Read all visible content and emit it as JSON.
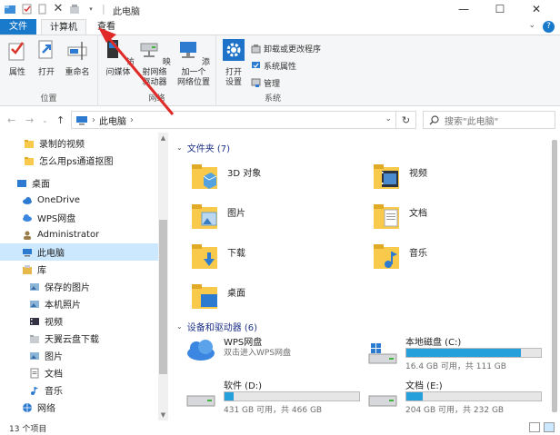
{
  "window": {
    "title": "此电脑",
    "minimize": "—",
    "maximize": "☐",
    "close": "✕"
  },
  "tabs": {
    "file": "文件",
    "computer": "计算机",
    "view": "查看"
  },
  "ribbon": {
    "location_group": "位置",
    "network_group": "网络",
    "system_group": "系统",
    "properties": "属性",
    "open": "打开",
    "rename": "重命名",
    "access_media_line1": "访问媒体",
    "map_drive_line1": "映射网络",
    "map_drive_line2": "驱动器",
    "add_location_line1": "添加一个",
    "add_location_line2": "网络位置",
    "open_settings_line1": "打开",
    "open_settings_line2": "设置",
    "uninstall": "卸载或更改程序",
    "system_properties": "系统属性",
    "manage": "管理"
  },
  "address": {
    "path": "此电脑",
    "separator": "›",
    "search_placeholder": "搜索\"此电脑\""
  },
  "sidebar": {
    "items": [
      {
        "label": "录制的视频",
        "icon": "folder-icon"
      },
      {
        "label": "怎么用ps通道抠图",
        "icon": "folder-icon"
      },
      {
        "label": "桌面",
        "icon": "desktop-icon"
      },
      {
        "label": "OneDrive",
        "icon": "cloud-icon"
      },
      {
        "label": "WPS网盘",
        "icon": "wps-cloud-icon"
      },
      {
        "label": "Administrator",
        "icon": "user-icon"
      },
      {
        "label": "此电脑",
        "icon": "computer-icon"
      },
      {
        "label": "库",
        "icon": "library-icon"
      },
      {
        "label": "保存的图片",
        "icon": "pictures-icon"
      },
      {
        "label": "本机照片",
        "icon": "pictures-icon"
      },
      {
        "label": "视频",
        "icon": "video-icon"
      },
      {
        "label": "天翼云盘下载",
        "icon": "folder-icon"
      },
      {
        "label": "图片",
        "icon": "pictures-icon"
      },
      {
        "label": "文档",
        "icon": "documents-icon"
      },
      {
        "label": "音乐",
        "icon": "music-icon"
      },
      {
        "label": "网络",
        "icon": "network-icon"
      }
    ]
  },
  "content": {
    "folders_header": "文件夹 (7)",
    "folders": [
      {
        "label": "3D 对象",
        "icon": "3d-objects-icon"
      },
      {
        "label": "视频",
        "icon": "video-folder-icon"
      },
      {
        "label": "图片",
        "icon": "pictures-folder-icon"
      },
      {
        "label": "文档",
        "icon": "documents-folder-icon"
      },
      {
        "label": "下载",
        "icon": "downloads-folder-icon"
      },
      {
        "label": "音乐",
        "icon": "music-folder-icon"
      },
      {
        "label": "桌面",
        "icon": "desktop-folder-icon"
      }
    ],
    "devices_header": "设备和驱动器 (6)",
    "drives": [
      {
        "name": "WPS网盘",
        "sub": "双击进入WPS网盘",
        "icon": "wps-cloud-icon",
        "fill": null
      },
      {
        "name": "本地磁盘 (C:)",
        "sub": "16.4 GB 可用，共 111 GB",
        "icon": "windows-drive-icon",
        "fill": 0.85
      },
      {
        "name": "软件 (D:)",
        "sub": "431 GB 可用，共 466 GB",
        "icon": "hard-drive-icon",
        "fill": 0.07
      },
      {
        "name": "文档 (E:)",
        "sub": "204 GB 可用，共 232 GB",
        "icon": "hard-drive-icon",
        "fill": 0.12
      }
    ]
  },
  "status": {
    "count": "13 个项目"
  },
  "colors": {
    "accent": "#1979ca",
    "folder": "#f8c94a",
    "drive_fill": "#26a0da",
    "selection": "#cce8ff",
    "arrow": "#e02a27"
  }
}
